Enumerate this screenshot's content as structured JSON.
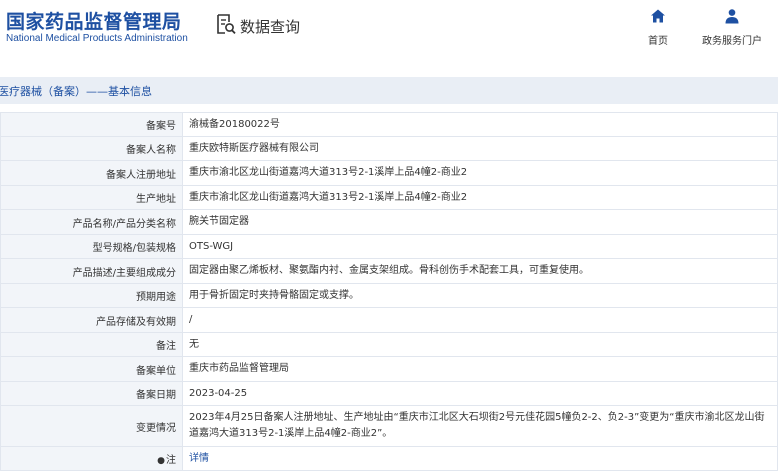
{
  "header": {
    "title_cn": "国家药品监督管理局",
    "title_en": "National Medical Products Administration",
    "query_label": "数据查询",
    "nav": {
      "home": "首页",
      "service": "政务服务门户"
    }
  },
  "breadcrumb": "医疗器械（备案）——基本信息",
  "colors": {
    "brand": "#1e50a2",
    "label_bg": "#f2f5f9",
    "bar_bg": "#e9eef5"
  },
  "rows": [
    {
      "label": "备案号",
      "value": "渝械备20180022号"
    },
    {
      "label": "备案人名称",
      "value": "重庆欧特斯医疗器械有限公司"
    },
    {
      "label": "备案人注册地址",
      "value": "重庆市渝北区龙山街道嘉鸿大道313号2-1溪岸上品4幢2-商业2"
    },
    {
      "label": "生产地址",
      "value": "重庆市渝北区龙山街道嘉鸿大道313号2-1溪岸上品4幢2-商业2"
    },
    {
      "label": "产品名称/产品分类名称",
      "value": "腕关节固定器"
    },
    {
      "label": "型号规格/包装规格",
      "value": "OTS-WGJ"
    },
    {
      "label": "产品描述/主要组成成分",
      "value": "固定器由聚乙烯板材、聚氨酯内衬、金属支架组成。骨科创伤手术配套工具，可重复使用。"
    },
    {
      "label": "预期用途",
      "value": "用于骨折固定时夹持骨骼固定或支撑。"
    },
    {
      "label": "产品存储及有效期",
      "value": "/"
    },
    {
      "label": "备注",
      "value": "无"
    },
    {
      "label": "备案单位",
      "value": "重庆市药品监督管理局"
    },
    {
      "label": "备案日期",
      "value": "2023-04-25"
    },
    {
      "label": "变更情况",
      "value": "2023年4月25日备案人注册地址、生产地址由“重庆市江北区大石坝街2号元佳花园5幢负2-2、负2-3”变更为“重庆市渝北区龙山街道嘉鸿大道313号2-1溪岸上品4幢2-商业2”。"
    },
    {
      "label": "注",
      "value": "详情"
    }
  ]
}
